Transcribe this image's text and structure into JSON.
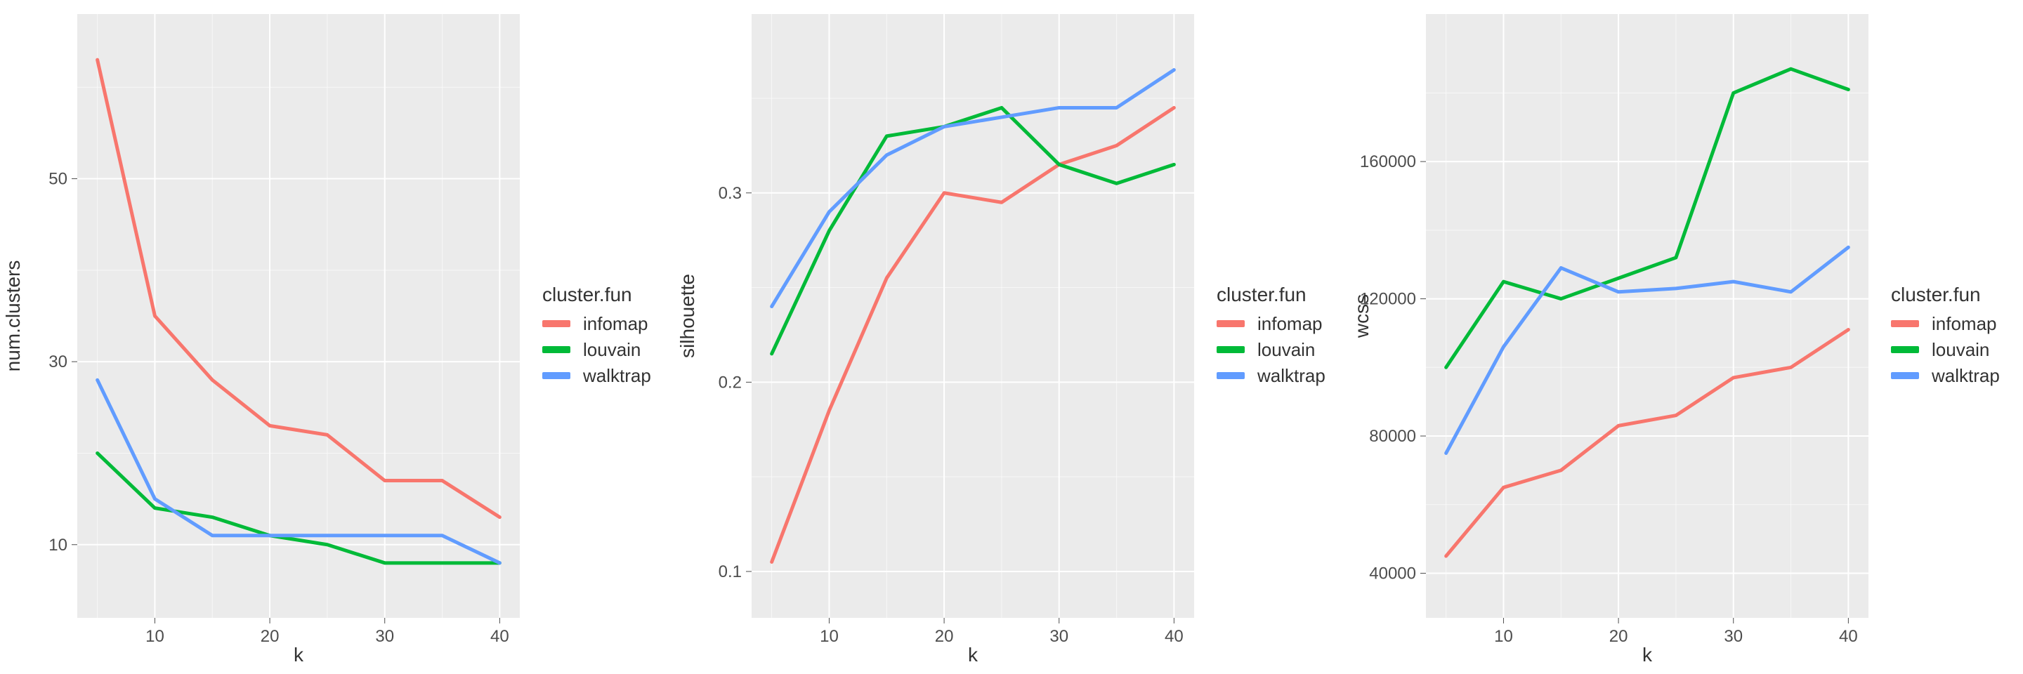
{
  "colors": {
    "infomap": "#F8766D",
    "louvain": "#00BA38",
    "walktrap": "#619CFF"
  },
  "legend_title": "cluster.fun",
  "legend_entries": [
    "infomap",
    "louvain",
    "walktrap"
  ],
  "xlabel": "k",
  "chart_data": [
    {
      "id": "panel1",
      "type": "line",
      "ylabel": "num.clusters",
      "xlabel": "k",
      "x": [
        5,
        10,
        15,
        20,
        25,
        30,
        35,
        40
      ],
      "xlim": [
        5,
        40
      ],
      "ylim": [
        5,
        65
      ],
      "xticks": [
        10,
        20,
        30,
        40
      ],
      "yticks": [
        10,
        30,
        50
      ],
      "series": [
        {
          "name": "infomap",
          "values": [
            63,
            35,
            28,
            23,
            22,
            17,
            17,
            13
          ]
        },
        {
          "name": "louvain",
          "values": [
            20,
            14,
            13,
            11,
            10,
            8,
            8,
            8
          ]
        },
        {
          "name": "walktrap",
          "values": [
            28,
            15,
            11,
            11,
            11,
            11,
            11,
            8
          ]
        }
      ]
    },
    {
      "id": "panel2",
      "type": "line",
      "ylabel": "silhouette",
      "xlabel": "k",
      "x": [
        5,
        10,
        15,
        20,
        25,
        30,
        35,
        40
      ],
      "xlim": [
        5,
        40
      ],
      "ylim": [
        0.09,
        0.38
      ],
      "xticks": [
        10,
        20,
        30,
        40
      ],
      "yticks": [
        0.1,
        0.2,
        0.3
      ],
      "series": [
        {
          "name": "infomap",
          "values": [
            0.105,
            0.185,
            0.255,
            0.3,
            0.295,
            0.315,
            0.325,
            0.345
          ]
        },
        {
          "name": "louvain",
          "values": [
            0.215,
            0.28,
            0.33,
            0.335,
            0.345,
            0.315,
            0.305,
            0.315
          ]
        },
        {
          "name": "walktrap",
          "values": [
            0.24,
            0.29,
            0.32,
            0.335,
            0.34,
            0.345,
            0.345,
            0.365
          ]
        }
      ]
    },
    {
      "id": "panel3",
      "type": "line",
      "ylabel": "wcss",
      "xlabel": "k",
      "x": [
        5,
        10,
        15,
        20,
        25,
        30,
        35,
        40
      ],
      "xlim": [
        5,
        40
      ],
      "ylim": [
        35000,
        195000
      ],
      "xticks": [
        10,
        20,
        30,
        40
      ],
      "yticks": [
        40000,
        80000,
        120000,
        160000
      ],
      "series": [
        {
          "name": "infomap",
          "values": [
            45000,
            65000,
            70000,
            83000,
            86000,
            97000,
            100000,
            111000
          ]
        },
        {
          "name": "louvain",
          "values": [
            100000,
            125000,
            120000,
            126000,
            132000,
            180000,
            187000,
            181000
          ]
        },
        {
          "name": "walktrap",
          "values": [
            75000,
            106000,
            129000,
            122000,
            123000,
            125000,
            122000,
            135000
          ]
        }
      ]
    }
  ]
}
